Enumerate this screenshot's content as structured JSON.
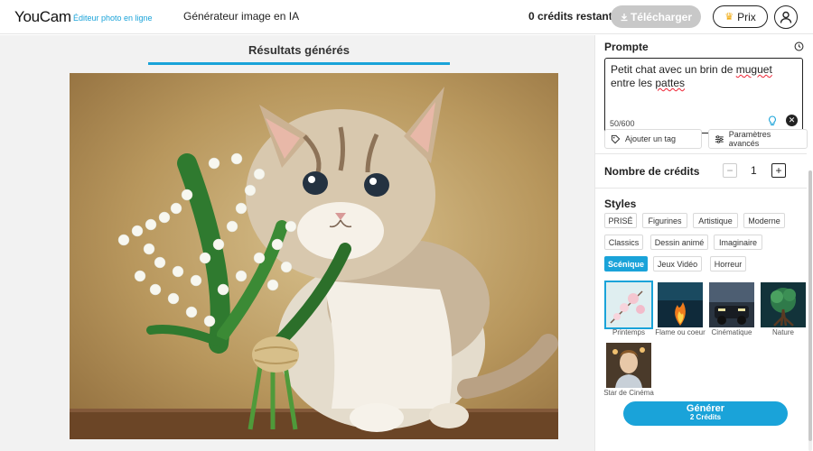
{
  "header": {
    "logo": "YouCam",
    "logo_sub": "Éditeur photo en ligne",
    "nav_title": "Générateur image en IA",
    "credits_remaining": "0 crédits restants",
    "download_label": "Télécharger",
    "price_label": "Prix"
  },
  "main": {
    "tab_label": "Résultats générés"
  },
  "panel": {
    "prompt_label": "Prompte",
    "prompt_text_before": "Petit chat avec un brin de ",
    "prompt_text_misspelled": "muguet",
    "prompt_text_after": " entre les ",
    "prompt_text_last": "pattes",
    "char_count": "50/600",
    "add_tag_label": "Ajouter un tag",
    "advanced_label": "Paramètres avancés",
    "credits_label": "Nombre de crédits",
    "credits_value": "1",
    "styles_label": "Styles",
    "style_chips": [
      "PRISÉ",
      "Figurines",
      "Artistique",
      "Moderne",
      "Classics",
      "Dessin animé",
      "Imaginaire",
      "Scénique",
      "Jeux Vidéo",
      "Horreur"
    ],
    "active_chip": "Scénique",
    "style_thumbs": [
      "Printemps",
      "Flame ou coeur",
      "Cinématique",
      "Nature",
      "Star de Cinéma"
    ],
    "selected_thumb": "Printemps",
    "generate_label": "Générer",
    "generate_cost": "2 Crédits"
  },
  "colors": {
    "accent": "#1aa3d9",
    "disabled": "#c8c8c8",
    "crown": "#f0a500"
  },
  "icons": [
    "crown-icon",
    "user-icon",
    "history-icon",
    "lightbulb-icon",
    "clear-icon",
    "tag-icon",
    "sliders-icon",
    "minus-icon",
    "plus-icon"
  ]
}
